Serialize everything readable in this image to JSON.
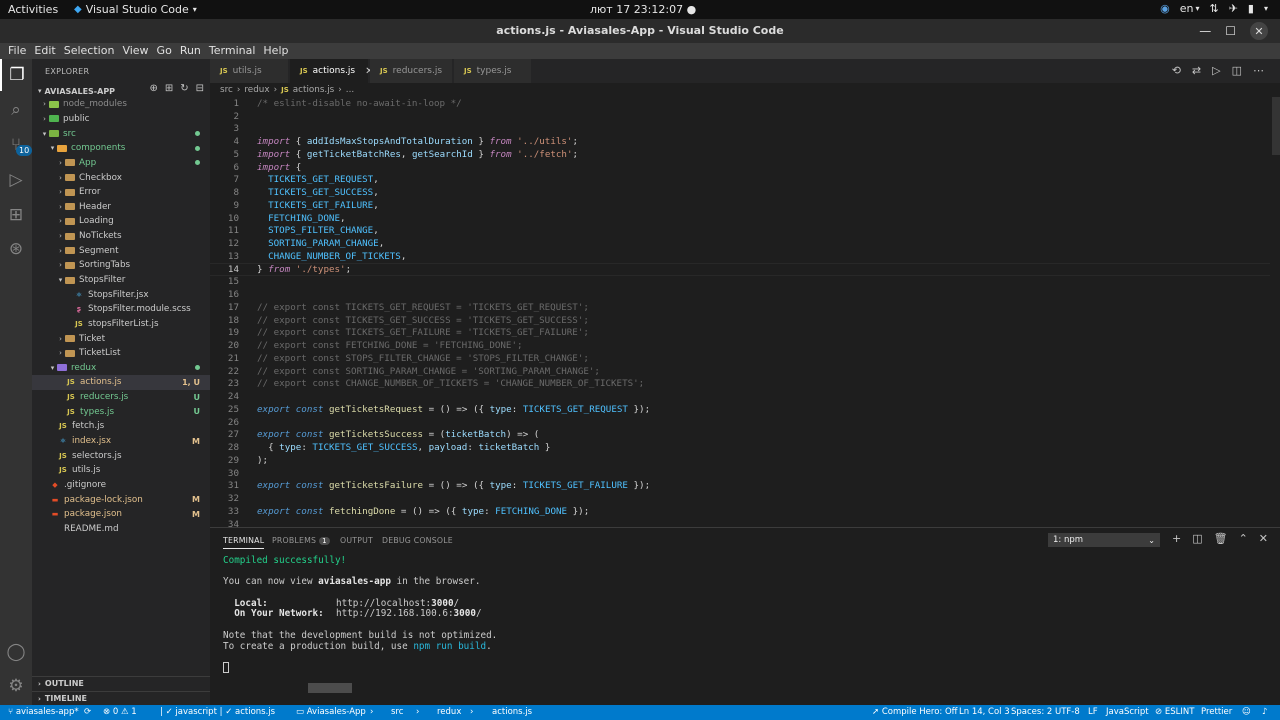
{
  "os_bar": {
    "activities": "Activities",
    "app_name": "Visual Studio Code",
    "clock": "лют 17  23:12:07",
    "language": "en"
  },
  "window": {
    "title": "actions.js - Aviasales-App - Visual Studio Code"
  },
  "menu": [
    "File",
    "Edit",
    "Selection",
    "View",
    "Go",
    "Run",
    "Terminal",
    "Help"
  ],
  "activity_bar": {
    "scm_badge": "10"
  },
  "explorer": {
    "title": "EXPLORER",
    "root": "AVIASALES-APP",
    "items": [
      {
        "label": "node_modules",
        "color": "#8c8c8c"
      },
      {
        "label": "public",
        "color": "#cccccc"
      },
      {
        "label": "src",
        "color": "#73c991"
      },
      {
        "label": "components",
        "color": "#73c991"
      },
      {
        "label": "App",
        "color": "#73c991"
      },
      {
        "label": "Checkbox",
        "color": "#cccccc"
      },
      {
        "label": "Error",
        "color": "#cccccc"
      },
      {
        "label": "Header",
        "color": "#cccccc"
      },
      {
        "label": "Loading",
        "color": "#cccccc"
      },
      {
        "label": "NoTickets",
        "color": "#cccccc"
      },
      {
        "label": "Segment",
        "color": "#cccccc"
      },
      {
        "label": "SortingTabs",
        "color": "#cccccc"
      },
      {
        "label": "StopsFilter",
        "color": "#cccccc"
      },
      {
        "label": "StopsFilter.jsx",
        "color": "#cccccc"
      },
      {
        "label": "StopsFilter.module.scss",
        "color": "#cccccc"
      },
      {
        "label": "stopsFilterList.js",
        "color": "#cccccc"
      },
      {
        "label": "Ticket",
        "color": "#cccccc"
      },
      {
        "label": "TicketList",
        "color": "#cccccc"
      },
      {
        "label": "redux",
        "color": "#73c991"
      },
      {
        "label": "actions.js",
        "color": "#e2c08d",
        "status": "1, U"
      },
      {
        "label": "reducers.js",
        "color": "#73c991",
        "status": "U"
      },
      {
        "label": "types.js",
        "color": "#73c991",
        "status": "U"
      },
      {
        "label": "fetch.js",
        "color": "#cccccc"
      },
      {
        "label": "index.jsx",
        "color": "#e2c08d",
        "status": "M"
      },
      {
        "label": "selectors.js",
        "color": "#cccccc"
      },
      {
        "label": "utils.js",
        "color": "#cccccc"
      },
      {
        "label": ".gitignore",
        "color": "#cccccc"
      },
      {
        "label": "package-lock.json",
        "color": "#e2c08d",
        "status": "M"
      },
      {
        "label": "package.json",
        "color": "#e2c08d",
        "status": "M"
      },
      {
        "label": "README.md",
        "color": "#cccccc"
      }
    ],
    "outline": "OUTLINE",
    "timeline": "TIMELINE"
  },
  "tabs": [
    "utils.js",
    "actions.js",
    "reducers.js",
    "types.js"
  ],
  "breadcrumb": [
    "src",
    "redux",
    "actions.js",
    "..."
  ],
  "code_lines": [
    "/* eslint-disable no-await-in-loop */",
    "",
    "",
    "import { addIdsMaxStopsAndTotalDuration } from '../utils';",
    "import { getTicketBatchRes, getSearchId } from '../fetch';",
    "import {",
    "  TICKETS_GET_REQUEST,",
    "  TICKETS_GET_SUCCESS,",
    "  TICKETS_GET_FAILURE,",
    "  FETCHING_DONE,",
    "  STOPS_FILTER_CHANGE,",
    "  SORTING_PARAM_CHANGE,",
    "  CHANGE_NUMBER_OF_TICKETS,",
    "} from './types';",
    "",
    "",
    "// export const TICKETS_GET_REQUEST = 'TICKETS_GET_REQUEST';",
    "// export const TICKETS_GET_SUCCESS = 'TICKETS_GET_SUCCESS';",
    "// export const TICKETS_GET_FAILURE = 'TICKETS_GET_FAILURE';",
    "// export const FETCHING_DONE = 'FETCHING_DONE';",
    "// export const STOPS_FILTER_CHANGE = 'STOPS_FILTER_CHANGE';",
    "// export const SORTING_PARAM_CHANGE = 'SORTING_PARAM_CHANGE';",
    "// export const CHANGE_NUMBER_OF_TICKETS = 'CHANGE_NUMBER_OF_TICKETS';",
    "",
    "export const getTicketsRequest = () => ({ type: TICKETS_GET_REQUEST });",
    "",
    "export const getTicketsSuccess = (ticketBatch) => (",
    "  { type: TICKETS_GET_SUCCESS, payload: ticketBatch }",
    ");",
    "",
    "export const getTicketsFailure = () => ({ type: TICKETS_GET_FAILURE });",
    "",
    "export const fetchingDone = () => ({ type: FETCHING_DONE });",
    ""
  ],
  "current_line": 14,
  "panel": {
    "tabs": [
      "TERMINAL",
      "PROBLEMS",
      "OUTPUT",
      "DEBUG CONSOLE"
    ],
    "problems_count": "1",
    "terminal_select": "1: npm",
    "terminal": {
      "compiled": "Compiled successfully!",
      "view_prefix": "You can now view ",
      "app": "aviasales-app",
      "view_suffix": " in the browser.",
      "local_label": "  Local:",
      "local_url_pre": "http://localhost:",
      "local_port": "3000",
      "local_url_post": "/",
      "network_label": "  On Your Network:",
      "network_url_pre": "http://192.168.100.6:",
      "network_port": "3000",
      "network_url_post": "/",
      "note1": "Note that the development build is not optimized.",
      "note2_pre": "To create a production build, use ",
      "note2_cmd": "npm run build",
      "note2_post": "."
    }
  },
  "statusbar": {
    "branch": "aviasales-app*",
    "errors": "0",
    "warnings": "1",
    "crumb_lang": "javascript",
    "crumb_file": "actions.js",
    "crumb_root": "Aviasales-App",
    "crumb_src": "src",
    "crumb_redux": "redux",
    "crumb_actions": "actions.js",
    "compile_hero": "Compile Hero: Off",
    "position": "Ln 14, Col 3",
    "spaces": "Spaces: 2",
    "encoding": "UTF-8",
    "eol": "LF",
    "language": "JavaScript",
    "eslint": "ESLINT",
    "prettier": "Prettier"
  }
}
